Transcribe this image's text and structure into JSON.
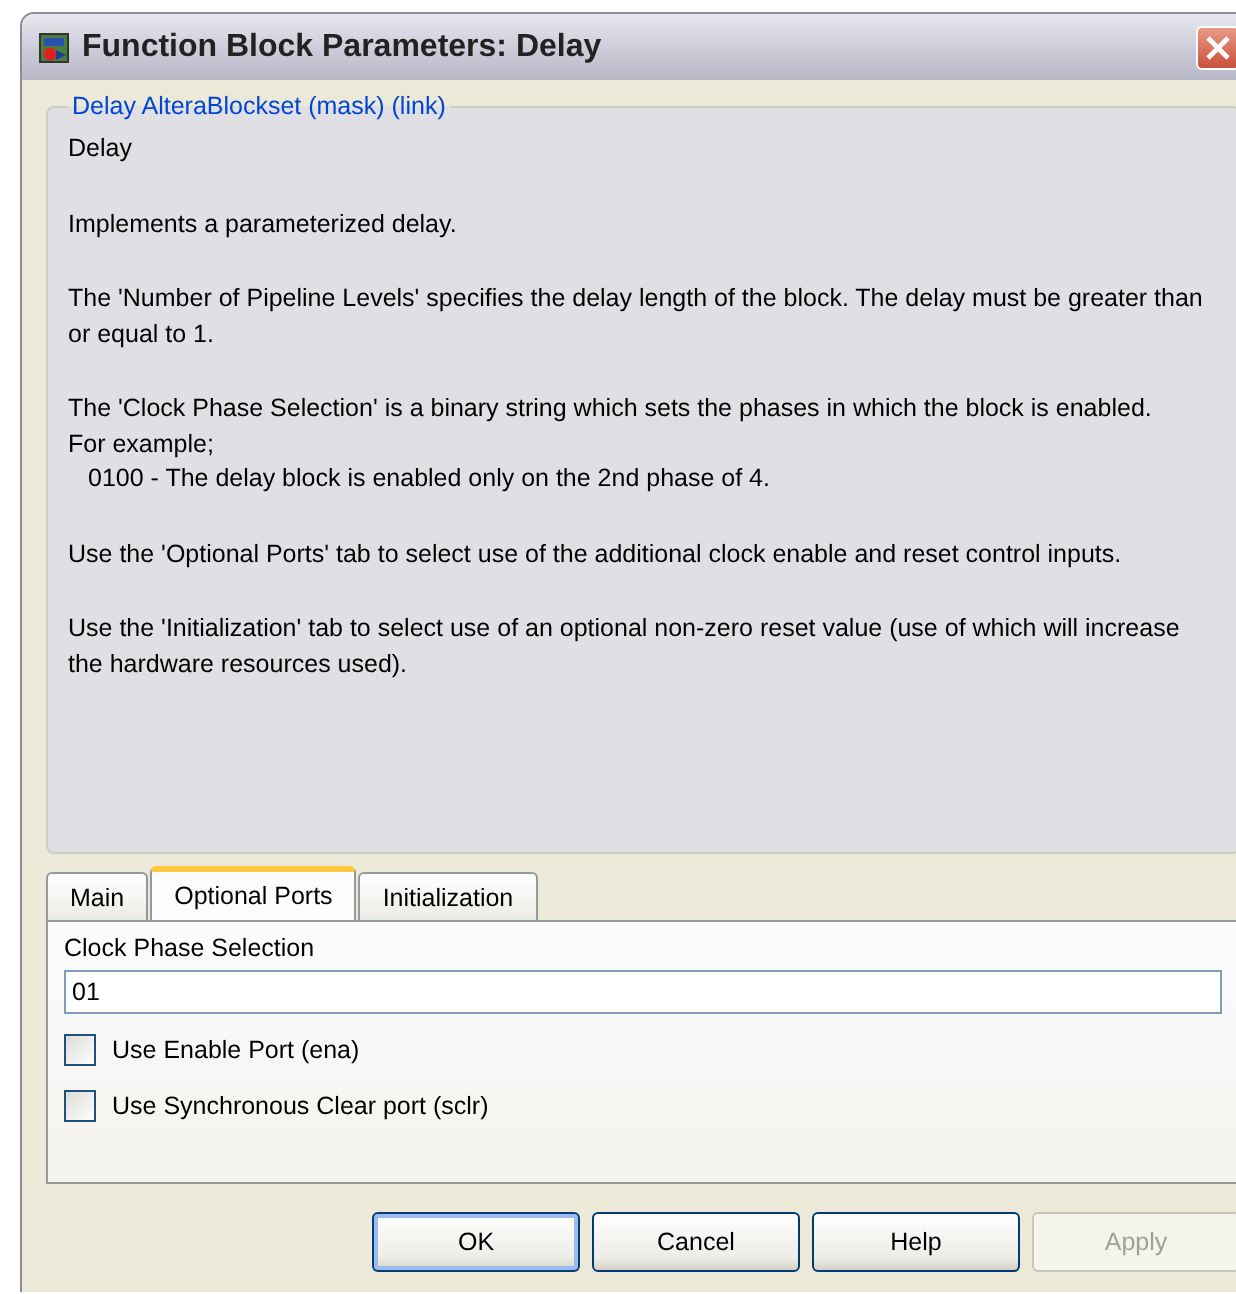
{
  "window": {
    "title": "Function Block Parameters: Delay"
  },
  "group": {
    "title": "Delay AlteraBlockset (mask) (link)",
    "description": [
      {
        "kind": "paragraph",
        "text": "Delay"
      },
      {
        "kind": "paragraph",
        "text": "Implements a parameterized delay."
      },
      {
        "kind": "paragraph",
        "text": "The 'Number of Pipeline Levels' specifies the delay length of the block. The delay must be greater than or equal to 1."
      },
      {
        "kind": "paragraph",
        "text": "The 'Clock Phase Selection' is a binary string which sets the phases in which the block is enabled."
      },
      {
        "kind": "line",
        "text": "For example;"
      },
      {
        "kind": "indented",
        "text": "0100 - The delay block is enabled only on the 2nd phase of 4."
      },
      {
        "kind": "paragraph",
        "text": "Use the 'Optional Ports' tab to select use of the additional clock enable and reset control inputs."
      },
      {
        "kind": "paragraph",
        "text": "Use the 'Initialization' tab to select use of an optional non-zero reset value (use of which will increase the hardware resources used)."
      }
    ]
  },
  "tabs": [
    {
      "label": "Main",
      "selected": false
    },
    {
      "label": "Optional Ports",
      "selected": true
    },
    {
      "label": "Initialization",
      "selected": false
    }
  ],
  "panel": {
    "field_label": "Clock Phase Selection",
    "field_value": "01",
    "checkboxes": [
      {
        "label": "Use Enable Port (ena)",
        "checked": false
      },
      {
        "label": "Use Synchronous Clear port (sclr)",
        "checked": false
      }
    ]
  },
  "buttons": [
    {
      "label": "OK",
      "default": true,
      "disabled": false
    },
    {
      "label": "Cancel",
      "default": false,
      "disabled": false
    },
    {
      "label": "Help",
      "default": false,
      "disabled": false
    },
    {
      "label": "Apply",
      "default": false,
      "disabled": true
    }
  ]
}
